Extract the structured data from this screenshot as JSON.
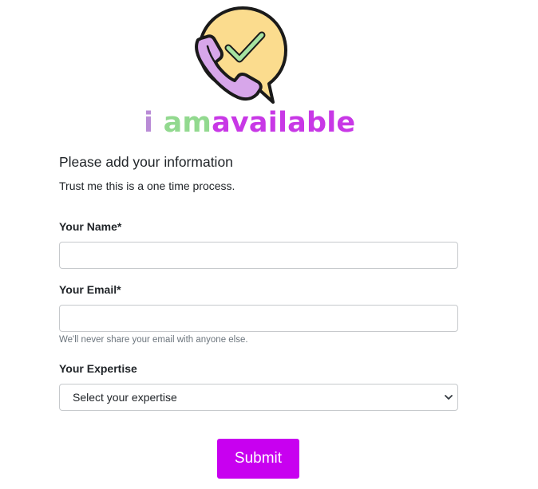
{
  "logo": {
    "text_i": "i ",
    "text_am": "am",
    "text_available": "available",
    "colors": {
      "i": "#b98bd6",
      "am": "#92d98f",
      "available": "#c838e6",
      "phone": "#d7a6ea",
      "badge": "#fbdc8e",
      "check": "#a6e3a1",
      "outline": "#1a1a1a"
    },
    "icon": "phone-check-icon"
  },
  "form": {
    "heading": "Please add your information",
    "subtext": "Trust me this is a one time process.",
    "name": {
      "label": "Your Name*",
      "value": "",
      "placeholder": ""
    },
    "email": {
      "label": "Your Email*",
      "value": "",
      "placeholder": "",
      "help": "We'll never share your email with anyone else."
    },
    "expertise": {
      "label": "Your Expertise",
      "selected": "Select your expertise",
      "icon": "chevron-down-icon"
    },
    "submit_label": "Submit",
    "accent_color": "#c800f0"
  }
}
